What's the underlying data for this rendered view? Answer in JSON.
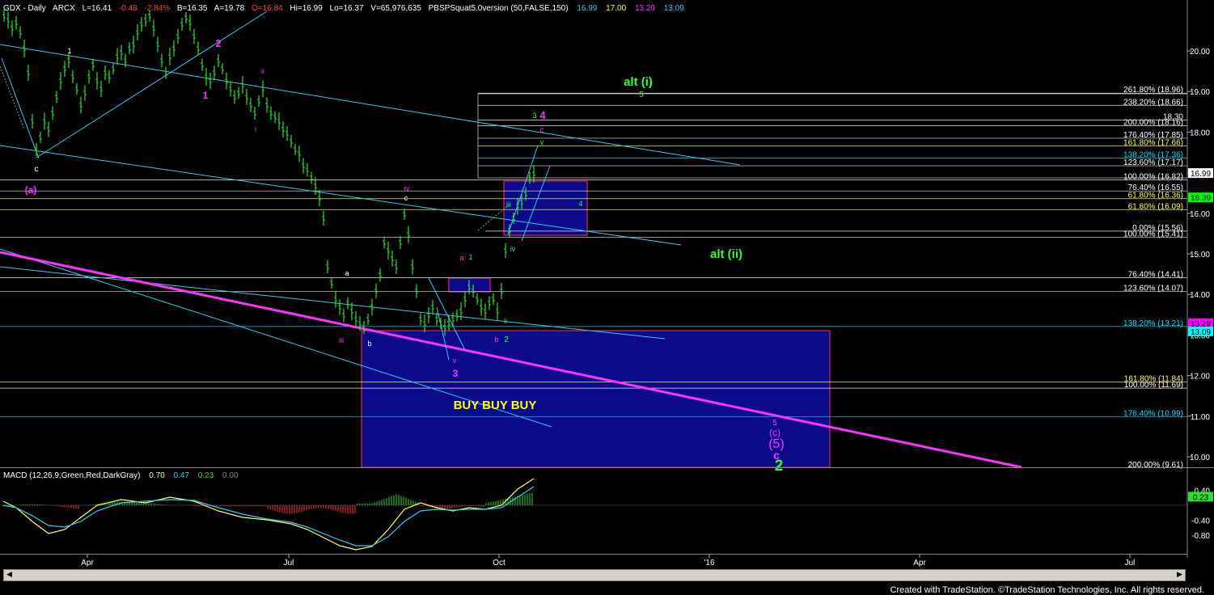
{
  "header": {
    "symbol": "GDX - Daily",
    "exchange": "ARCX",
    "last": "L=16.41",
    "change": "-0.48",
    "change_pct": "-2.84%",
    "bid": "B=16.35",
    "ask": "A=19.78",
    "open": "O=16.84",
    "high": "Hi=16.99",
    "low": "Lo=16.37",
    "volume": "V=65,976,635",
    "indicator": "PBSPSquat5.0version (50,FALSE,150)",
    "ind_v1": "16.99",
    "ind_v2": "17.00",
    "ind_v3": "13.29",
    "ind_v4": "13.09"
  },
  "macd_header": {
    "label": "MACD (12,26,9,Green,Red,DarkGray)",
    "v1": "0.70",
    "v2": "0.47",
    "v3": "0.23",
    "v4": "0.00"
  },
  "footer": "Created with TradeStation. ©TradeStation Technologies, Inc. All rights reserved.",
  "chart_data": {
    "type": "bar",
    "title": "GDX - Daily",
    "x_tick_labels": [
      "Apr",
      "Jul",
      "Oct",
      "'16",
      "Apr",
      "Jul"
    ],
    "y_tick_labels": [
      "20.00",
      "19.00",
      "18.00",
      "17.00",
      "16.00",
      "15.00",
      "14.00",
      "13.00",
      "12.00",
      "11.00",
      "10.00"
    ],
    "ylim": [
      9.8,
      21.1
    ],
    "price_tags": [
      {
        "value": 16.99,
        "label": "16.99",
        "color": "#ffffff"
      },
      {
        "value": 16.39,
        "label": "16.39",
        "color": "#00ff00"
      },
      {
        "value": 13.29,
        "label": "13.29",
        "color": "#ff00ff"
      },
      {
        "value": 13.09,
        "label": "13.09",
        "color": "#00ffff"
      }
    ],
    "fib_levels": [
      {
        "label": "261.80% (18.96)",
        "value": 18.96,
        "color": "#ffffff"
      },
      {
        "label": "238.20% (18.66)",
        "value": 18.66,
        "color": "#ffffff"
      },
      {
        "label": "18.30",
        "value": 18.3,
        "color": "#ffffff"
      },
      {
        "label": "200.00% (18.16)",
        "value": 18.16,
        "color": "#ffffff"
      },
      {
        "label": "176.40% (17.85)",
        "value": 17.85,
        "color": "#ffffff"
      },
      {
        "label": "161.80% (17.66)",
        "value": 17.66,
        "color": "#ffff66"
      },
      {
        "label": "138.20% (17.36)",
        "value": 17.36,
        "color": "#00e5ff"
      },
      {
        "label": "123.60% (17.17)",
        "value": 17.17,
        "color": "#ffffff"
      },
      {
        "label": "100.00% (16.82)",
        "value": 16.82,
        "color": "#ffffff"
      },
      {
        "label": "76.40% (16.55)",
        "value": 16.55,
        "color": "#ffffff"
      },
      {
        "label": "61.80% (16.36)",
        "value": 16.36,
        "color": "#ffff66"
      },
      {
        "label": "61.80% (16.09)",
        "value": 16.09,
        "color": "#ffff66"
      },
      {
        "label": "0.00% (15.56)",
        "value": 15.56,
        "color": "#ffffff"
      },
      {
        "label": "100.00% (15.41)",
        "value": 15.41,
        "color": "#ffffff"
      },
      {
        "label": "76.40% (14.41)",
        "value": 14.41,
        "color": "#ffffff"
      },
      {
        "label": "123.60% (14.07)",
        "value": 14.07,
        "color": "#ffffff"
      },
      {
        "label": "138.20% (13.21)",
        "value": 13.21,
        "color": "#00e5ff"
      },
      {
        "label": "161.80% (11.84)",
        "value": 11.84,
        "color": "#ffff66"
      },
      {
        "label": "100.00% (11.69)",
        "value": 11.69,
        "color": "#ffffff"
      },
      {
        "label": "176.40% (10.99)",
        "value": 10.99,
        "color": "#00e5ff"
      },
      {
        "label": "200.00% (9.61)",
        "value": 9.61,
        "color": "#ffffff"
      }
    ],
    "annotations": [
      {
        "text": "c",
        "color": "#ffffff"
      },
      {
        "text": "(a)",
        "color": "#ff33ff"
      },
      {
        "text": "1",
        "color": "#ffffff"
      },
      {
        "text": "2",
        "color": "#ff33ff"
      },
      {
        "text": "1",
        "color": "#ff33ff"
      },
      {
        "text": "ii",
        "color": "#ff33ff"
      },
      {
        "text": "i",
        "color": "#ff33ff"
      },
      {
        "text": "iv",
        "color": "#ff33ff"
      },
      {
        "text": "c",
        "color": "#ffffff"
      },
      {
        "text": "a",
        "color": "#ffffff"
      },
      {
        "text": "iii",
        "color": "#ff33ff"
      },
      {
        "text": "b",
        "color": "#ffffff"
      },
      {
        "text": "v",
        "color": "#ff33ff"
      },
      {
        "text": "3",
        "color": "#ff33ff"
      },
      {
        "text": "a",
        "color": "#ff33ff"
      },
      {
        "text": "1",
        "color": "#33ff33"
      },
      {
        "text": "b",
        "color": "#ff33ff"
      },
      {
        "text": "2",
        "color": "#33ff33"
      },
      {
        "text": "ii",
        "color": "#33ff33"
      },
      {
        "text": "iii",
        "color": "#33ff33"
      },
      {
        "text": "iv",
        "color": "#33ff33"
      },
      {
        "text": "v",
        "color": "#33ff33"
      },
      {
        "text": "4",
        "color": "#33ff33"
      },
      {
        "text": "3",
        "color": "#33ff33"
      },
      {
        "text": "4",
        "color": "#ff33ff"
      },
      {
        "text": "c",
        "color": "#ff33ff"
      },
      {
        "text": "alt (i)",
        "color": "#33ff33"
      },
      {
        "text": "5",
        "color": "#33ff33"
      },
      {
        "text": "alt (ii)",
        "color": "#33ff33"
      },
      {
        "text": "BUY  BUY  BUY",
        "color": "#ffff00"
      },
      {
        "text": "5",
        "color": "#ff33ff"
      },
      {
        "text": "(c)",
        "color": "#ff33ff"
      },
      {
        "text": "(5)",
        "color": "#ff33ff"
      },
      {
        "text": "c",
        "color": "#ff33ff"
      },
      {
        "text": "2",
        "color": "#33ff33"
      }
    ],
    "macd": {
      "y_tick_labels": [
        "0.40",
        "-0.40",
        "-0.80"
      ],
      "value_tag": "0.23",
      "ylim": [
        -1.0,
        0.6
      ]
    }
  },
  "colors": {
    "background": "#000000",
    "bars": "#33dd33",
    "magenta_trend": "#ff33ff",
    "channel": "#33ccee",
    "box": "#0a0a8a"
  }
}
